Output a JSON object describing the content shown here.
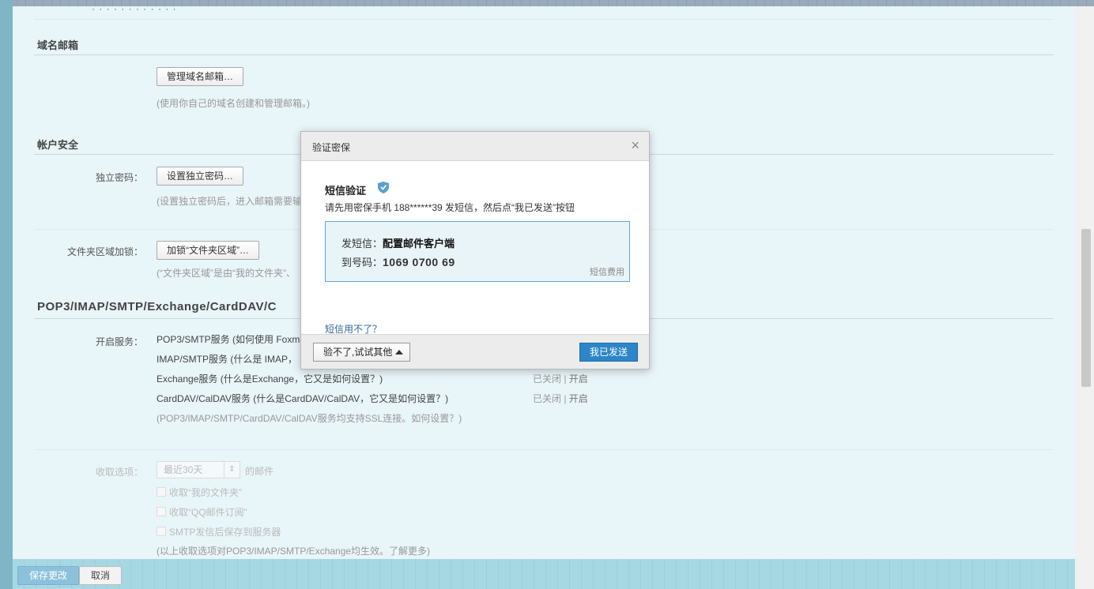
{
  "top": {
    "cut_text": "· · · · · · · · · · · ·"
  },
  "domain_mail": {
    "title": "域名邮箱",
    "manage_button": "管理域名邮箱…",
    "hint": "(使用你自己的域名创建和管理邮箱。)"
  },
  "account_security": {
    "title": "帐户安全",
    "standalone_label": "独立密码：",
    "standalone_button": "设置独立密码…",
    "standalone_hint": "(设置独立密码后，进入邮箱需要输",
    "folder_label": "文件夹区域加锁：",
    "folder_button": "加锁“文件夹区域”…",
    "folder_hint": "(“文件夹区域”是由“我的文件夹”、"
  },
  "protocols": {
    "title": "POP3/IMAP/SMTP/Exchange/CardDAV/C",
    "enable_label": "开启服务：",
    "services": [
      {
        "name": "POP3/SMTP服务 (如何使用 Foxm",
        "status": "",
        "action": ""
      },
      {
        "name": "IMAP/SMTP服务 (什么是 IMAP，",
        "status": "",
        "action": ""
      },
      {
        "name": "Exchange服务 (什么是Exchange，它又是如何设置？)",
        "status": "已关闭 |",
        "action": "开启"
      },
      {
        "name": "CardDAV/CalDAV服务 (什么是CardDAV/CalDAV，它又是如何设置？)",
        "status": "已关闭 |",
        "action": "开启"
      }
    ],
    "ssl_hint": "(POP3/IMAP/SMTP/CardDAV/CalDAV服务均支持SSL连接。如何设置？)"
  },
  "receive": {
    "label": "收取选项：",
    "select_value": "最近30天",
    "select_suffix": "的邮件",
    "opt1": "收取“我的文件夹”",
    "opt2": "收取“QQ邮件订阅”",
    "opt3": "SMTP发信后保存到服务器",
    "hint": "(以上收取选项对POP3/IMAP/SMTP/Exchange均生效。了解更多)"
  },
  "footer": {
    "save": "保存更改",
    "cancel": "取消"
  },
  "dialog": {
    "title": "验证密保",
    "close": "×",
    "heading": "短信验证",
    "desc": "请先用密保手机 188******39 发短信，然后点“我已发送”按钮",
    "sms_content_label": "发短信：",
    "sms_content": "配置邮件客户端",
    "sms_to_label": "到号码：",
    "sms_to": "1069 0700 69",
    "fee": "短信费用",
    "help": "短信用不了？",
    "other_button": "验不了,试试其他",
    "sent_button": "我已发送"
  },
  "colors": {
    "accent": "#2c86c8",
    "page_bg": "#e8f5f9",
    "sms_border": "#5fa9cc"
  }
}
